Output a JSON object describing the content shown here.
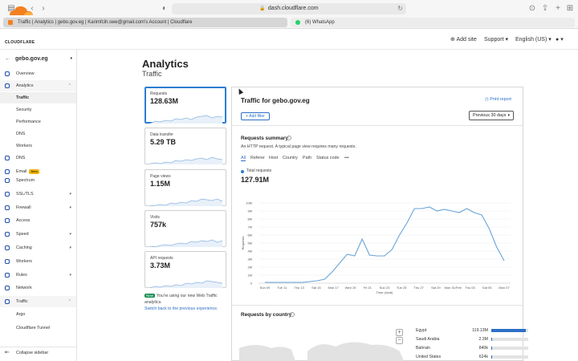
{
  "browser": {
    "url": "dash.cloudflare.com",
    "tabs": [
      {
        "label": "Traffic | Analytics | gebo.gov.eg | Karimfcih.swe@gmail.com's Account | Cloudflare"
      },
      {
        "label": "(6) WhatsApp"
      }
    ]
  },
  "header": {
    "logo_text": "CLOUDFLARE",
    "add_site": "Add site",
    "support": "Support",
    "language": "English (US)"
  },
  "sidebar": {
    "account": "gebo.gov.eg",
    "items": [
      {
        "label": "Overview",
        "icon": "document-icon"
      },
      {
        "label": "Analytics",
        "icon": "chart-icon"
      },
      {
        "label": "Traffic",
        "sub": true
      },
      {
        "label": "Security",
        "sub": true
      },
      {
        "label": "Performance",
        "sub": true
      },
      {
        "label": "DNS",
        "sub": true
      },
      {
        "label": "Workers",
        "sub": true
      },
      {
        "label": "DNS",
        "icon": "network-icon"
      },
      {
        "label": "Email",
        "icon": "email-icon",
        "badge": "Beta"
      },
      {
        "label": "Spectrum",
        "icon": "spectrum-icon"
      },
      {
        "label": "SSL/TLS",
        "icon": "lock-icon"
      },
      {
        "label": "Firewall",
        "icon": "firewall-icon"
      },
      {
        "label": "Access",
        "icon": "access-icon"
      },
      {
        "label": "Speed",
        "icon": "speed-icon"
      },
      {
        "label": "Caching",
        "icon": "caching-icon"
      },
      {
        "label": "Workers",
        "icon": "workers-icon"
      },
      {
        "label": "Rules",
        "icon": "rules-icon"
      },
      {
        "label": "Network",
        "icon": "network-icon"
      },
      {
        "label": "Traffic",
        "icon": "traffic-icon"
      },
      {
        "label": "Argo",
        "sub": true
      },
      {
        "label": "Cloudflare Tunnel",
        "sub": true
      }
    ],
    "collapse": "Collapse sidebar"
  },
  "page": {
    "title": "Analytics",
    "subtitle": "Traffic"
  },
  "cards": [
    {
      "label": "Requests",
      "value": "128.63M",
      "selected": true
    },
    {
      "label": "Data transfer",
      "value": "5.29 TB"
    },
    {
      "label": "Page views",
      "value": "1.15M"
    },
    {
      "label": "Visits",
      "value": "757k"
    },
    {
      "label": "API requests",
      "value": "3.73M"
    }
  ],
  "notice": {
    "badge": "New",
    "text": "You're using our new Web Traffic analytics.",
    "link": "Switch back to the previous experience."
  },
  "panel": {
    "title": "Traffic for gebo.gov.eg",
    "print": "Print report",
    "add_filter": "Add filter",
    "period": "Previous 30 days",
    "summary_title": "Requests summary",
    "summary_desc": "An HTTP request. A typical page view requires many requests.",
    "filter_tabs": [
      "All",
      "Referer",
      "Host",
      "Country",
      "Path",
      "Status code",
      "•••"
    ],
    "series_label": "Total requests",
    "series_value": "127.91M",
    "countries_title": "Requests by country",
    "countries": [
      {
        "name": "Egypt",
        "value": "119.13M",
        "share": 0.93
      },
      {
        "name": "Saudi Arabia",
        "value": "2.3M",
        "share": 0.02
      },
      {
        "name": "Bahrain",
        "value": "840k",
        "share": 0.01
      },
      {
        "name": "United States",
        "value": "624k",
        "share": 0.005
      }
    ]
  },
  "colors": {
    "accent": "#2c6fc6",
    "line": "#6aa3d8",
    "brand": "#f38020"
  },
  "chart_data": {
    "type": "line",
    "xlabel": "Time (local)",
    "ylabel": "Requests",
    "ylim": [
      0,
      10
    ],
    "yticks": [
      "0",
      "1M",
      "2M",
      "3M",
      "4M",
      "5M",
      "6M",
      "7M",
      "8M",
      "9M",
      "10M"
    ],
    "xticks": [
      "Sun 09",
      "Tue 11",
      "Thu 13",
      "Sat 15",
      "Mon 17",
      "Wed 19",
      "Fri 21",
      "Sun 23",
      "Tue 25",
      "Thu 27",
      "Sat 29",
      "Mon 31/Feb",
      "Thu 03",
      "Sat 05",
      "Mon 07"
    ],
    "series": [
      {
        "values": [
          0.1,
          0.1,
          0.1,
          0.1,
          0.1,
          0.1,
          0.2,
          0.3,
          0.5,
          1.4,
          2.5,
          3.6,
          3.4,
          5.5,
          3.5,
          3.4,
          3.4,
          4.2,
          6.0,
          7.5,
          9.3,
          9.3,
          9.5,
          9.0,
          9.2,
          9.0,
          8.8,
          9.3,
          8.8,
          8.5,
          6.8,
          4.5,
          2.8
        ]
      }
    ]
  }
}
